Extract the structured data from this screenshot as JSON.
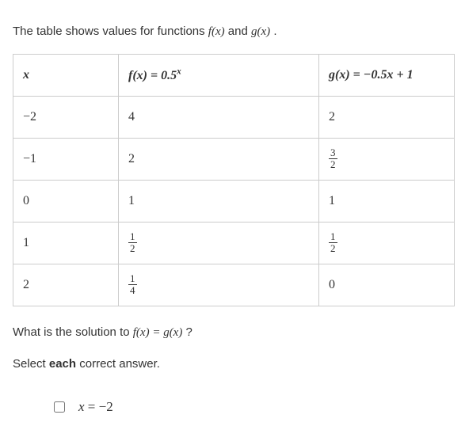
{
  "intro": {
    "prefix": "The table shows values for functions ",
    "f": "f(x)",
    "and": " and ",
    "g": "g(x)",
    "suffix": " ."
  },
  "table": {
    "headers": {
      "x": "x",
      "fx_base": "f(x) = 0.5",
      "fx_sup": "x",
      "gx": "g(x) = −0.5x + 1"
    },
    "rows": [
      {
        "x": "−2",
        "f": "4",
        "g": "2"
      },
      {
        "x": "−1",
        "f": "2",
        "g_frac_num": "3",
        "g_frac_den": "2"
      },
      {
        "x": "0",
        "f": "1",
        "g": "1"
      },
      {
        "x": "1",
        "f_frac_num": "1",
        "f_frac_den": "2",
        "g_frac_num": "1",
        "g_frac_den": "2"
      },
      {
        "x": "2",
        "f_frac_num": "1",
        "f_frac_den": "4",
        "g": "0"
      }
    ]
  },
  "question": {
    "prefix": "What is the solution to ",
    "eq": "f(x) = g(x)",
    "suffix": " ?"
  },
  "select_prefix": "Select ",
  "select_bold": "each",
  "select_suffix": " correct answer.",
  "answers": {
    "a1_var": "x",
    "a1_eq": " = ",
    "a1_val": "−2"
  }
}
